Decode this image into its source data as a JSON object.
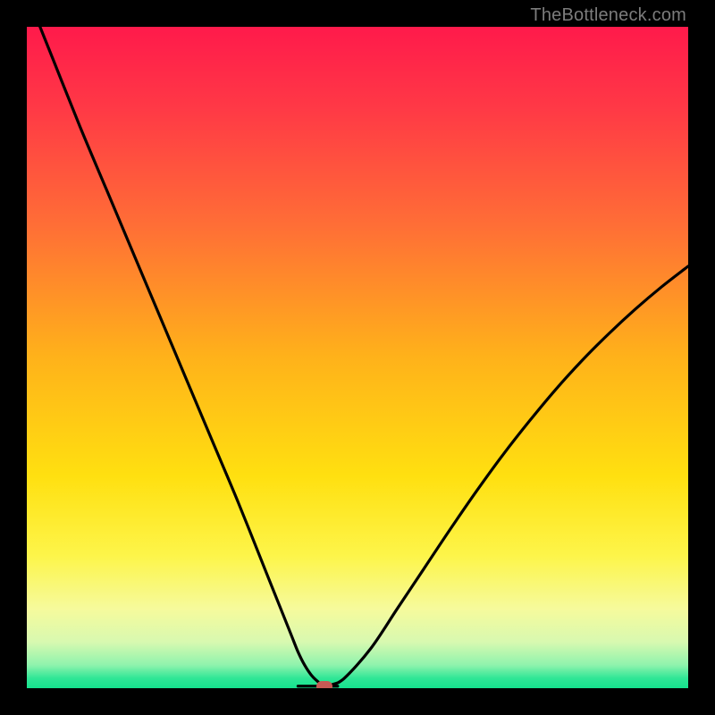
{
  "watermark": "TheBottleneck.com",
  "chart_data": {
    "type": "line",
    "title": "",
    "xlabel": "",
    "ylabel": "",
    "xlim": [
      0,
      100
    ],
    "ylim": [
      0,
      100
    ],
    "gradient_stops": [
      {
        "offset": 0,
        "color": "#ff1a4b"
      },
      {
        "offset": 0.12,
        "color": "#ff3846"
      },
      {
        "offset": 0.3,
        "color": "#ff6e36"
      },
      {
        "offset": 0.5,
        "color": "#ffb21a"
      },
      {
        "offset": 0.68,
        "color": "#ffe010"
      },
      {
        "offset": 0.8,
        "color": "#fdf54a"
      },
      {
        "offset": 0.88,
        "color": "#f6fa9c"
      },
      {
        "offset": 0.93,
        "color": "#d8f9b0"
      },
      {
        "offset": 0.965,
        "color": "#8ff3ad"
      },
      {
        "offset": 0.985,
        "color": "#2fe696"
      },
      {
        "offset": 1.0,
        "color": "#15e28d"
      }
    ],
    "series": [
      {
        "name": "bottleneck-curve",
        "x": [
          0,
          4,
          8,
          12,
          16,
          20,
          24,
          28,
          32,
          36,
          38,
          40,
          41,
          42,
          43,
          44,
          45,
          46,
          48,
          52,
          56,
          60,
          64,
          68,
          72,
          76,
          80,
          84,
          88,
          92,
          96,
          100
        ],
        "y": [
          105,
          95,
          85,
          75.5,
          66,
          56.5,
          47,
          37.5,
          28,
          18,
          13,
          8,
          5.5,
          3.5,
          2,
          1,
          0.3,
          0.5,
          1.5,
          6,
          12,
          18,
          24,
          29.8,
          35.3,
          40.4,
          45.2,
          49.6,
          53.6,
          57.3,
          60.7,
          63.8
        ]
      }
    ],
    "min_point": {
      "x": 45,
      "y": 0.3,
      "color": "#c75a55"
    },
    "flat_segment": {
      "x_start": 41,
      "x_end": 47,
      "y": 0.3
    }
  }
}
